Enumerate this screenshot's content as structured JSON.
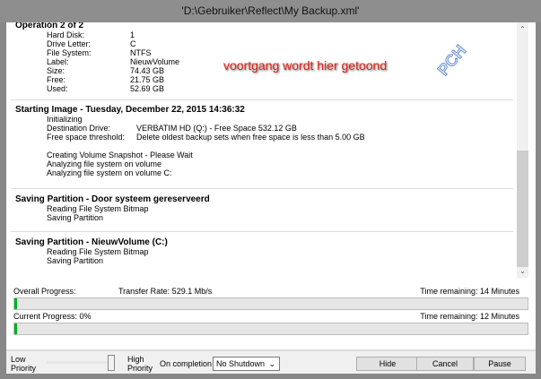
{
  "window": {
    "title": "'D:\\Gebruiker\\Reflect\\My Backup.xml'"
  },
  "log": {
    "operation": {
      "heading": "Operation 2 of 2",
      "fields": [
        {
          "k": "Hard Disk:",
          "v": "1"
        },
        {
          "k": "Drive Letter:",
          "v": "C"
        },
        {
          "k": "File System:",
          "v": "NTFS"
        },
        {
          "k": "Label:",
          "v": "NieuwVolume"
        },
        {
          "k": "Size:",
          "v": "74.43 GB"
        },
        {
          "k": "Free:",
          "v": "21.75 GB"
        },
        {
          "k": "Used:",
          "v": "52.69 GB"
        }
      ]
    },
    "starting": {
      "heading": "Starting Image - Tuesday, December 22, 2015 14:36:32",
      "line1": "Initializing",
      "fields": [
        {
          "k": "Destination Drive:",
          "v": "VERBATIM HD (Q:) - Free Space 532.12 GB"
        },
        {
          "k": "Free space threshold:",
          "v": "Delete oldest backup sets when free space is less than 5.00 GB"
        }
      ],
      "lines": [
        "Creating Volume Snapshot - Please Wait",
        "Analyzing file system on volume",
        "Analyzing file system on volume C:"
      ]
    },
    "part1": {
      "heading": "Saving Partition - Door systeem gereserveerd",
      "lines": [
        "Reading File System Bitmap",
        "Saving Partition"
      ]
    },
    "part2": {
      "heading": "Saving Partition - NieuwVolume (C:)",
      "lines": [
        "Reading File System Bitmap",
        "Saving Partition"
      ]
    }
  },
  "annotation": "voortgang wordt hier getoond",
  "watermark": "PCH",
  "progress": {
    "overall_label": "Overall Progress:",
    "transfer_rate": "Transfer Rate: 529.1 Mb/s",
    "overall_remaining": "Time remaining: 14 Minutes",
    "overall_fraction": 0.005,
    "current_label": "Current Progress:  0%",
    "current_remaining": "Time remaining: 12 Minutes",
    "current_fraction": 0.005,
    "fill_color": "#06b025"
  },
  "footer": {
    "low": "Low",
    "low2": "Priority",
    "high": "High",
    "high2": "Priority",
    "priority_value": 1.0,
    "on_completion": "On completion",
    "shutdown": "No Shutdown",
    "hide": "Hide",
    "cancel": "Cancel",
    "pause": "Pause"
  }
}
